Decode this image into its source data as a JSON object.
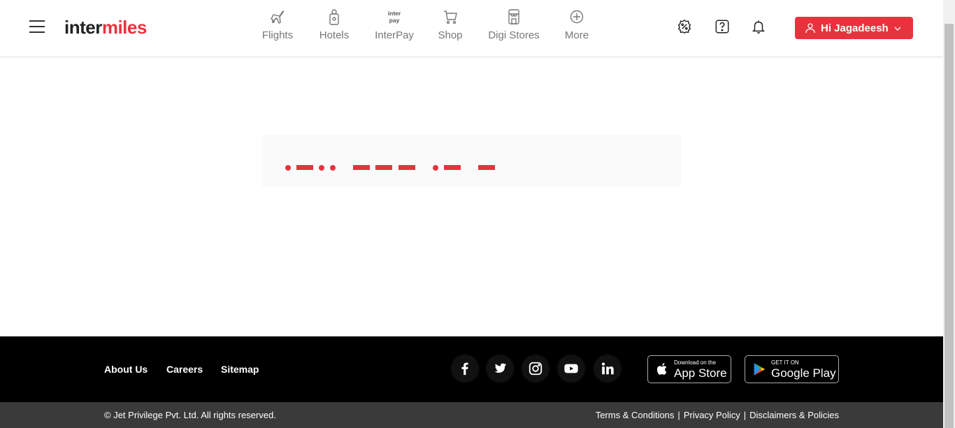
{
  "header": {
    "logo": {
      "part1": "inter",
      "part2": "miles"
    },
    "nav": [
      {
        "label": "Flights",
        "icon": "plane-icon"
      },
      {
        "label": "Hotels",
        "icon": "door-hanger-icon"
      },
      {
        "label": "InterPay",
        "icon": "interpay-icon",
        "icon_text": [
          "inter",
          "pay"
        ]
      },
      {
        "label": "Shop",
        "icon": "cart-icon"
      },
      {
        "label": "Digi Stores",
        "icon": "store-icon"
      },
      {
        "label": "More",
        "icon": "plus-circle-icon"
      }
    ],
    "icons": [
      "percent-badge-icon",
      "help-icon",
      "bell-icon"
    ],
    "user_button": {
      "label": "Hi Jagadeesh",
      "icon": "user-icon",
      "caret": "chevron-down-icon"
    }
  },
  "loader": {
    "color": "#e8333f"
  },
  "footer": {
    "links": [
      "About Us",
      "Careers",
      "Sitemap"
    ],
    "social": [
      "facebook-icon",
      "twitter-icon",
      "instagram-icon",
      "youtube-icon",
      "linkedin-icon"
    ],
    "app_store": {
      "small": "Download on the",
      "big": "App Store"
    },
    "google_play": {
      "small": "GET IT ON",
      "big": "Google Play"
    },
    "copyright": "© Jet Privilege Pvt. Ltd. All rights reserved.",
    "legal": [
      "Terms & Conditions",
      "Privacy Policy",
      "Disclaimers & Policies"
    ],
    "separator": "|"
  },
  "colors": {
    "accent": "#e8333f",
    "footer_bg": "#000000",
    "bottombar_bg": "#3a3a3a"
  }
}
